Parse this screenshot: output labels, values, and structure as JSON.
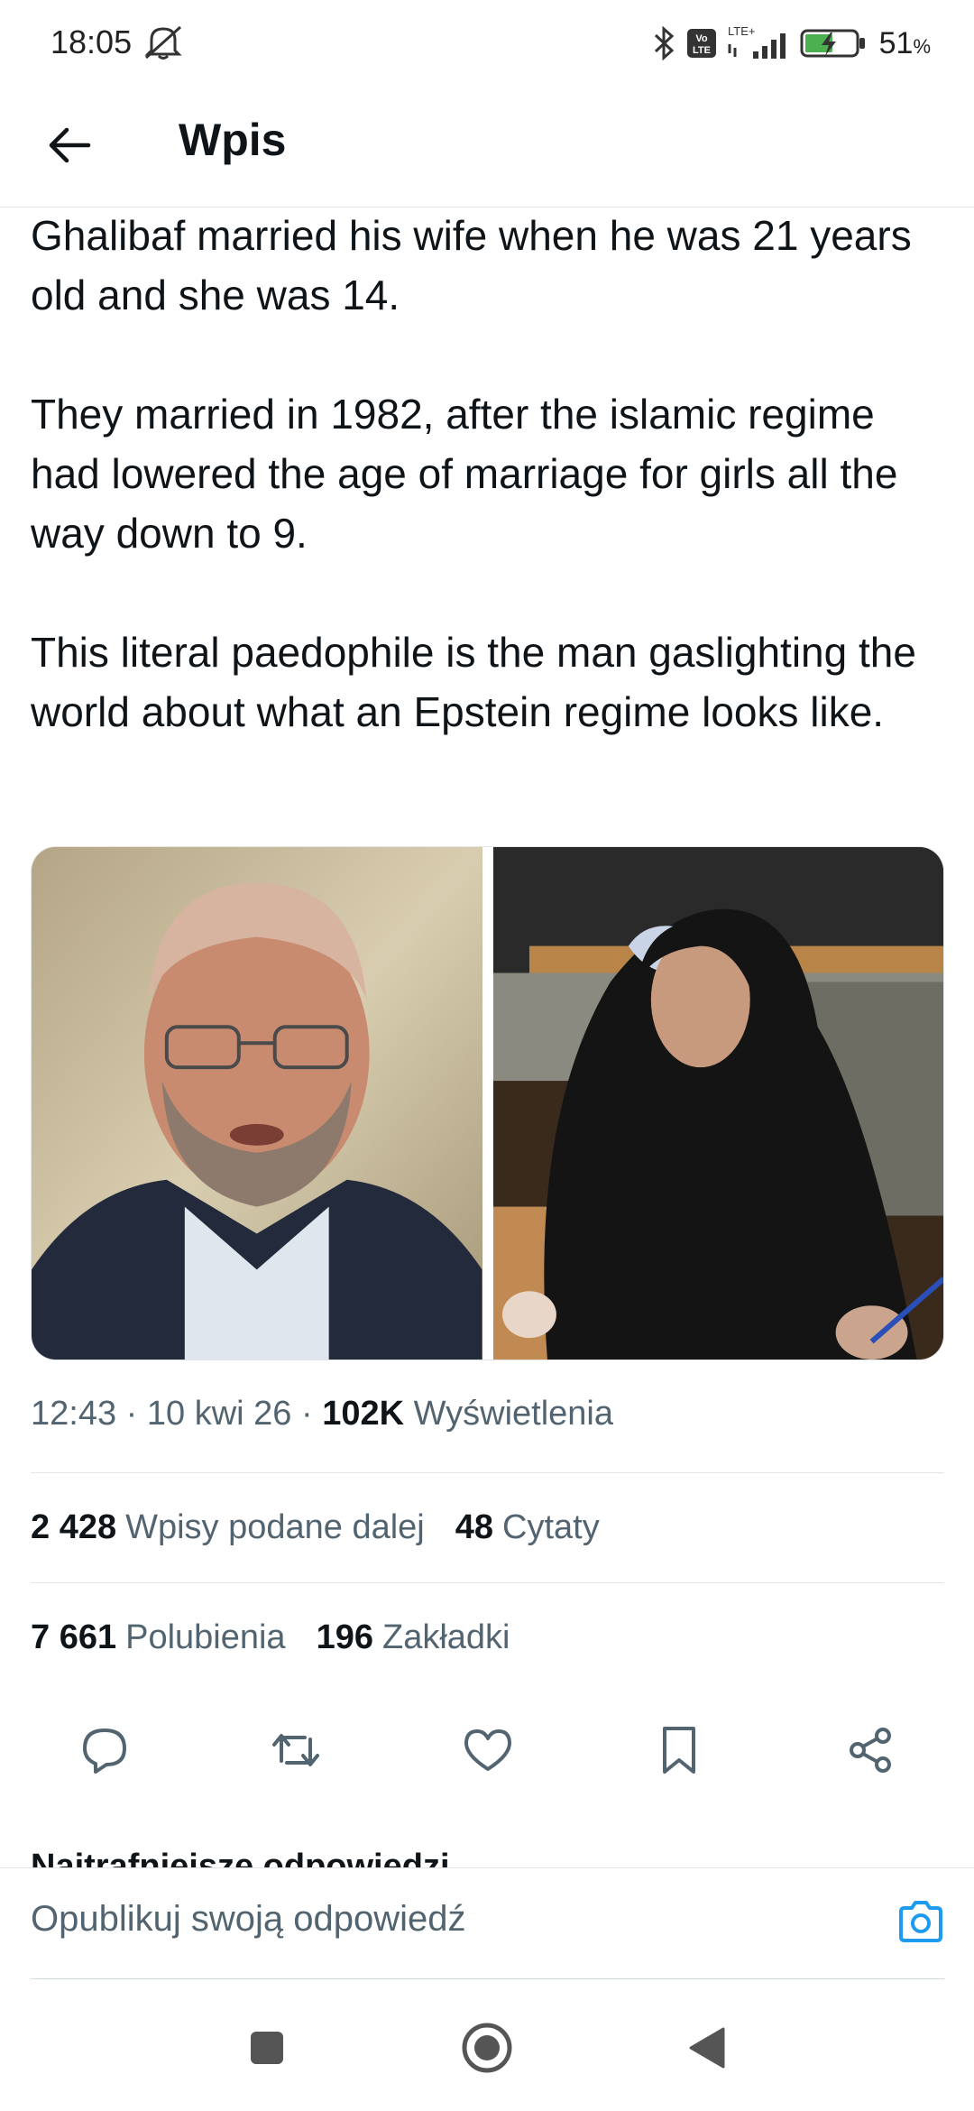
{
  "status_bar": {
    "time": "18:05",
    "network_label": "LTE+",
    "volte_label": "Vo LTE",
    "battery_percent": "51",
    "battery_unit": "%"
  },
  "header": {
    "title": "Wpis"
  },
  "tweet": {
    "paragraphs": [
      "Ghalibaf married his wife when he was 21 years old and she was 14.",
      "They married in 1982, after the islamic regime had lowered the age of marriage for girls all the way down to 9.",
      "This literal paedophile is the man gaslighting the world about what an Epstein regime looks like."
    ],
    "time": "12:43",
    "date": "10 kwi 26",
    "views_count": "102K",
    "views_label": "Wyświetlenia",
    "separator": " · "
  },
  "stats": {
    "reposts_count": "2 428",
    "reposts_label": "Wpisy podane dalej",
    "quotes_count": "48",
    "quotes_label": "Cytaty",
    "likes_count": "7 661",
    "likes_label": "Polubienia",
    "bookmarks_count": "196",
    "bookmarks_label": "Zakładki"
  },
  "replies": {
    "sort_label": "Najtrafniejsze odpowiedzi"
  },
  "composer": {
    "placeholder": "Opublikuj swoją odpowiedź"
  },
  "colors": {
    "accent": "#1d9bf0",
    "text_primary": "#0f1419",
    "text_secondary": "#536471",
    "divider": "#e3e6e8"
  },
  "icons": {
    "back": "arrow-left-icon",
    "reply": "reply-bubble-icon",
    "repost": "repost-icon",
    "like": "heart-icon",
    "bookmark": "bookmark-icon",
    "share": "share-icon",
    "camera": "camera-icon"
  }
}
